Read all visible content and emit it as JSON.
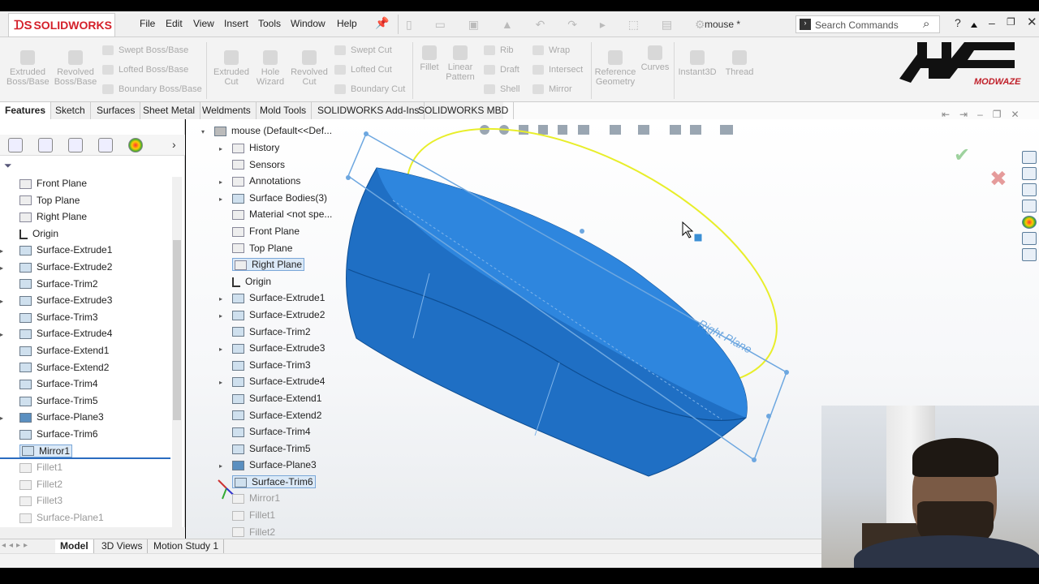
{
  "app": {
    "brand": "SOLIDWORKS",
    "document_title": "mouse *",
    "search_placeholder": "Search Commands"
  },
  "menu": [
    "File",
    "Edit",
    "View",
    "Insert",
    "Tools",
    "Window",
    "Help"
  ],
  "ribbon": {
    "big": [
      "Extruded\nBoss/Base",
      "Revolved\nBoss/Base",
      "Extruded\nCut",
      "Hole\nWizard",
      "Revolved\nCut",
      "Fillet",
      "Linear\nPattern",
      "Reference\nGeometry",
      "Curves",
      "Instant3D",
      "Thread"
    ],
    "small": [
      "Swept Boss/Base",
      "Lofted Boss/Base",
      "Boundary Boss/Base",
      "Swept Cut",
      "Lofted Cut",
      "Boundary Cut",
      "Rib",
      "Draft",
      "Shell",
      "Wrap",
      "Intersect",
      "Mirror"
    ]
  },
  "command_tabs": [
    "Features",
    "Sketch",
    "Surfaces",
    "Sheet Metal",
    "Weldments",
    "Mold Tools",
    "SOLIDWORKS Add-Ins",
    "SOLIDWORKS MBD"
  ],
  "left_tree": [
    "Front Plane",
    "Top Plane",
    "Right Plane",
    "Origin",
    "Surface-Extrude1",
    "Surface-Extrude2",
    "Surface-Trim2",
    "Surface-Extrude3",
    "Surface-Trim3",
    "Surface-Extrude4",
    "Surface-Extend1",
    "Surface-Extend2",
    "Surface-Trim4",
    "Surface-Trim5",
    "Surface-Plane3",
    "Surface-Trim6",
    "Mirror1",
    "Fillet1",
    "Fillet2",
    "Fillet3",
    "Surface-Plane1"
  ],
  "flyout_tree": {
    "root": "mouse  (Default<<Def...",
    "items": [
      "History",
      "Sensors",
      "Annotations",
      "Surface Bodies(3)",
      "Material <not spe...",
      "Front Plane",
      "Top Plane",
      "Right Plane",
      "Origin",
      "Surface-Extrude1",
      "Surface-Extrude2",
      "Surface-Trim2",
      "Surface-Extrude3",
      "Surface-Trim3",
      "Surface-Extrude4",
      "Surface-Extend1",
      "Surface-Extend2",
      "Surface-Trim4",
      "Surface-Trim5",
      "Surface-Plane3",
      "Surface-Trim6",
      "Mirror1",
      "Fillet1",
      "Fillet2"
    ]
  },
  "viewport": {
    "plane_label": "Right Plane"
  },
  "bottom_tabs": [
    "Model",
    "3D Views",
    "Motion Study 1"
  ],
  "watermark": {
    "text": "مدوارز",
    "subtitle": "MODWAZE"
  },
  "colors": {
    "model_blue": "#1f6fc4",
    "sketch_yellow": "#e8ee2a",
    "plane_blue": "#6da7e0",
    "logo_red": "#d4202a"
  }
}
